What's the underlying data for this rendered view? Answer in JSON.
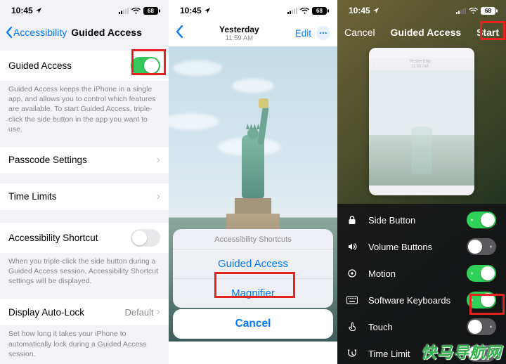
{
  "status": {
    "time": "10:45",
    "battery": "68"
  },
  "panel1": {
    "back": "Accessibility",
    "title": "Guided Access",
    "toggle_label": "Guided Access",
    "toggle_footer": "Guided Access keeps the iPhone in a single app, and allows you to control which features are available. To start Guided Access, triple-click the side button in the app you want to use.",
    "passcode": "Passcode Settings",
    "timelimits": "Time Limits",
    "shortcut_label": "Accessibility Shortcut",
    "shortcut_footer": "When you triple-click the side button during a Guided Access session, Accessibility Shortcut settings will be displayed.",
    "autolock_label": "Display Auto-Lock",
    "autolock_value": "Default",
    "autolock_footer": "Set how long it takes your iPhone to automatically lock during a Guided Access session."
  },
  "panel2": {
    "center_title": "Yesterday",
    "center_sub": "11:59 AM",
    "edit": "Edit",
    "sheet_title": "Accessibility Shortcuts",
    "opt1": "Guided Access",
    "opt2": "Magnifier",
    "cancel": "Cancel"
  },
  "panel3": {
    "cancel": "Cancel",
    "title": "Guided Access",
    "start": "Start",
    "preview_title": "Yesterday",
    "preview_sub": "11:59 AM",
    "options": [
      {
        "icon": "lock",
        "label": "Side Button",
        "on": true
      },
      {
        "icon": "speaker",
        "label": "Volume Buttons",
        "on": false
      },
      {
        "icon": "motion",
        "label": "Motion",
        "on": true
      },
      {
        "icon": "keyboard",
        "label": "Software Keyboards",
        "on": true
      },
      {
        "icon": "touch",
        "label": "Touch",
        "on": false
      },
      {
        "icon": "time",
        "label": "Time Limit",
        "on": false
      }
    ]
  },
  "watermark": "快马导航网"
}
